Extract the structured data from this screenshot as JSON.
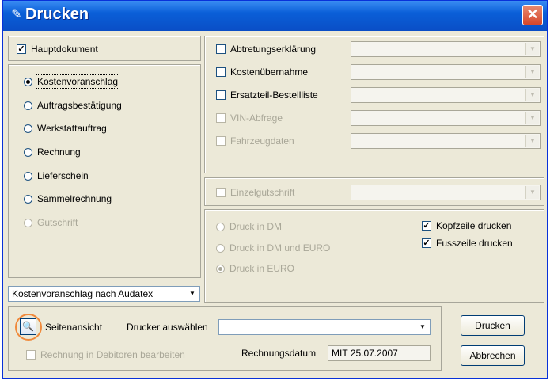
{
  "window": {
    "title": "Drucken",
    "close_glyph": "✕"
  },
  "left": {
    "hauptdokument": {
      "label": "Hauptdokument",
      "checked": true
    },
    "radios": [
      {
        "label": "Kostenvoranschlag",
        "selected": true,
        "enabled": true
      },
      {
        "label": "Auftragsbestätigung",
        "selected": false,
        "enabled": true
      },
      {
        "label": "Werkstattauftrag",
        "selected": false,
        "enabled": true
      },
      {
        "label": "Rechnung",
        "selected": false,
        "enabled": true
      },
      {
        "label": "Lieferschein",
        "selected": false,
        "enabled": true
      },
      {
        "label": "Sammelrechnung",
        "selected": false,
        "enabled": true
      },
      {
        "label": "Gutschrift",
        "selected": false,
        "enabled": false
      }
    ],
    "template_combo": {
      "value": "Kostenvoranschlag nach Audatex"
    }
  },
  "right": {
    "checks": [
      {
        "label": "Abtretungserklärung",
        "enabled": true
      },
      {
        "label": "Kostenübernahme",
        "enabled": true
      },
      {
        "label": "Ersatzteil-Bestellliste",
        "enabled": true
      },
      {
        "label": "VIN-Abfrage",
        "enabled": false
      },
      {
        "label": "Fahrzeugdaten",
        "enabled": false
      }
    ],
    "einzelgutschrift": {
      "label": "Einzelgutschrift",
      "enabled": false
    },
    "currency_radios": [
      {
        "label": "Druck in DM",
        "selected": false
      },
      {
        "label": "Druck in DM und EURO",
        "selected": false
      },
      {
        "label": "Druck in EURO",
        "selected": true
      }
    ],
    "kopfzeile": {
      "label": "Kopfzeile drucken",
      "checked": true
    },
    "fusszeile": {
      "label": "Fusszeile drucken",
      "checked": true
    }
  },
  "bottom": {
    "preview_label": "Seitenansicht",
    "printer_label": "Drucker auswählen",
    "printer_value": "",
    "debitoren_label": "Rechnung in Debitoren bearbeiten",
    "rechnungsdatum_label": "Rechnungsdatum",
    "rechnungsdatum_value": "MIT 25.07.2007",
    "print_button": "Drucken",
    "cancel_button": "Abbrechen"
  },
  "colors": {
    "titlebar": "#0a5fd8",
    "dialog_bg": "#ece9d8",
    "highlight_circle": "#f08a3c"
  }
}
